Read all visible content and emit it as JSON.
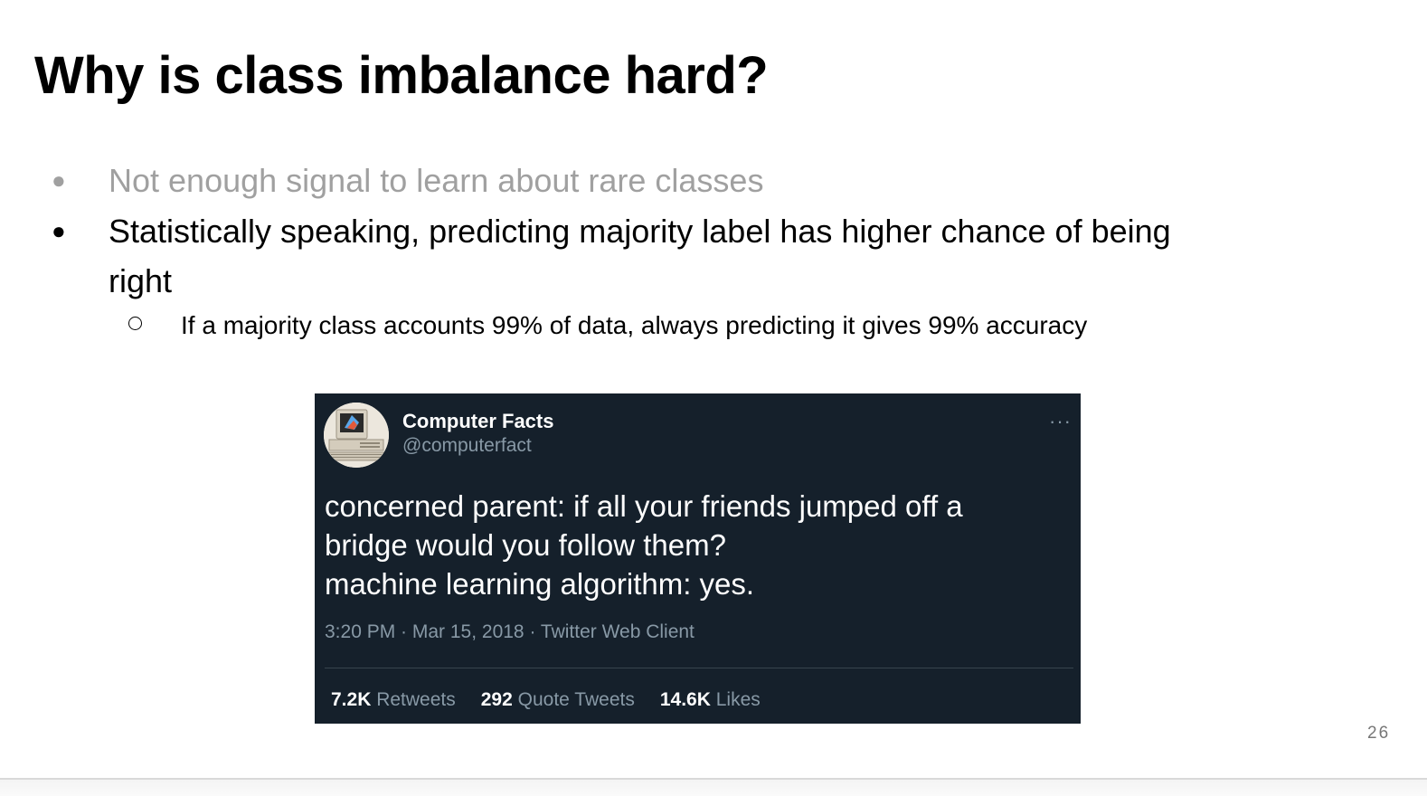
{
  "slide": {
    "title": "Why is class imbalance hard?",
    "bullets": [
      {
        "text": "Not enough signal to learn about rare classes"
      },
      {
        "line1": "Statistically speaking, predicting majority label has higher chance of being",
        "line2": "right"
      }
    ],
    "sub_bullet": "If a majority class accounts 99% of data, always predicting it gives 99% accuracy",
    "page_number": "26"
  },
  "tweet": {
    "name": "Computer Facts",
    "handle": "@computerfact",
    "more": "···",
    "lines": [
      "concerned parent: if all your friends jumped off a",
      "bridge would you follow them?",
      "machine learning algorithm: yes."
    ],
    "meta": "3:20 PM · Mar 15, 2018 · Twitter Web Client",
    "stats": {
      "retweets_count": "7.2K",
      "retweets_label": "Retweets",
      "quotes_count": "292",
      "quotes_label": "Quote Tweets",
      "likes_count": "14.6K",
      "likes_label": "Likes"
    }
  },
  "colors": {
    "tweet_bg": "#15202b",
    "muted_text": "#8899a6",
    "faded_bullet": "#a0a0a0"
  },
  "icons": {
    "avatar": "retro-computer-avatar-icon",
    "more": "more-options-icon"
  }
}
